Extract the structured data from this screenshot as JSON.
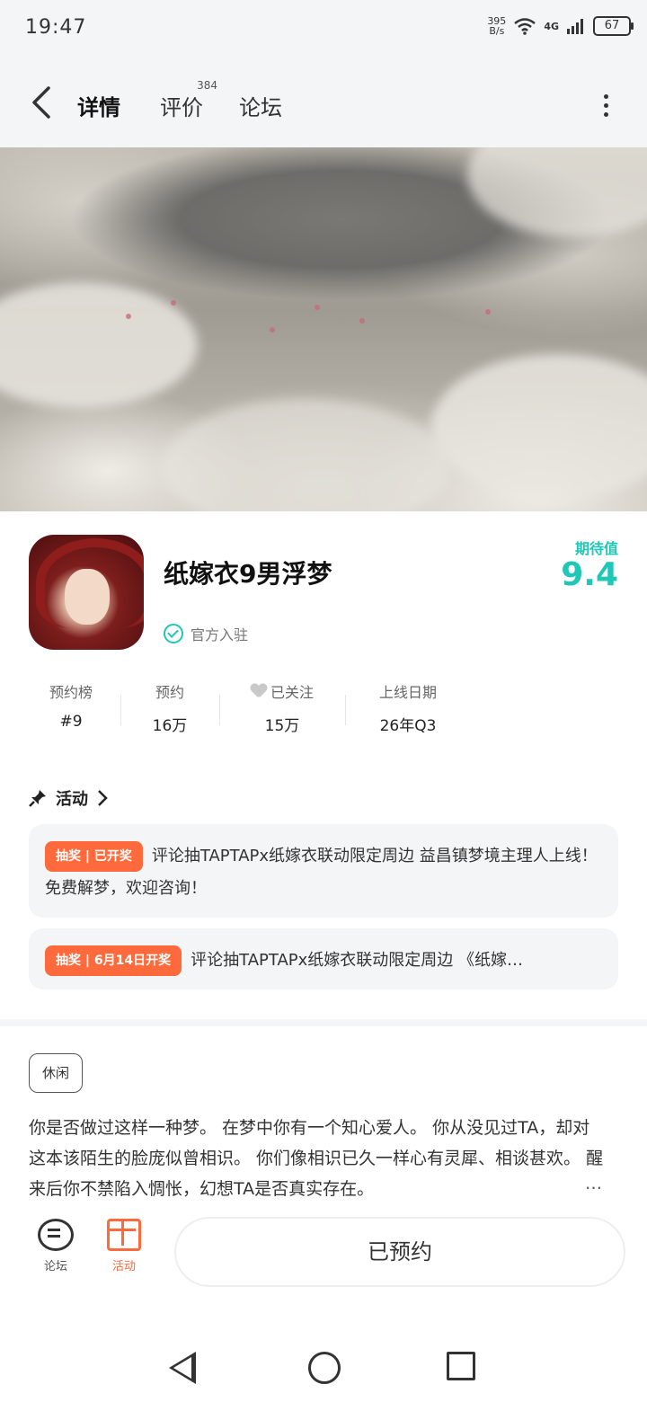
{
  "status": {
    "time": "19:47",
    "net_speed_top": "395",
    "net_speed_bottom": "B/s",
    "network": "4G",
    "battery": "67"
  },
  "nav": {
    "tabs": [
      {
        "label": "详情"
      },
      {
        "label": "评价",
        "badge": "384"
      },
      {
        "label": "论坛"
      }
    ]
  },
  "game": {
    "title": "纸嫁衣9男浮梦",
    "official_label": "官方入驻",
    "expect_label": "期待值",
    "expect_score": "9.4",
    "stats": [
      {
        "label": "预约榜",
        "value": "#9"
      },
      {
        "label": "预约",
        "value": "16万"
      },
      {
        "label": "已关注",
        "value": "15万"
      },
      {
        "label": "上线日期",
        "value": "26年Q3"
      }
    ]
  },
  "activities": {
    "heading": "活动",
    "items": [
      {
        "badge": "抽奖 | 已开奖",
        "text": "评论抽TAPTAPx纸嫁衣联动限定周边 益昌镇梦境主理人上线！免费解梦，欢迎咨询！"
      },
      {
        "badge": "抽奖 | 6月14日开奖",
        "text": "评论抽TAPTAPx纸嫁衣联动限定周边 《纸嫁…"
      }
    ]
  },
  "detail": {
    "tag": "休闲",
    "description": "你是否做过这样一种梦。 在梦中你有一个知心爱人。 你从没见过TA，却对这本该陌生的脸庞似曾相识。 你们像相识已久一样心有灵犀、相谈甚欢。 醒来后你不禁陷入惆怅，幻想TA是否真实存在。",
    "more": "…"
  },
  "bottom": {
    "forum_label": "论坛",
    "activity_label": "活动",
    "reserve_label": "已预约"
  },
  "colors": {
    "accent": "#1fc7b6",
    "lottery": "#ff6a3d"
  }
}
